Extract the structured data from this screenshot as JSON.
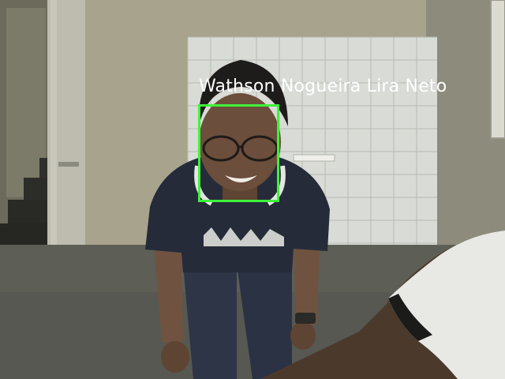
{
  "detection": {
    "label": "Wathson Nogueira Lira Neto",
    "box_color": "#3ef23a",
    "label_color": "#ffffff"
  },
  "scene": {
    "icons": [
      "person-photo",
      "face-detection-box"
    ]
  }
}
